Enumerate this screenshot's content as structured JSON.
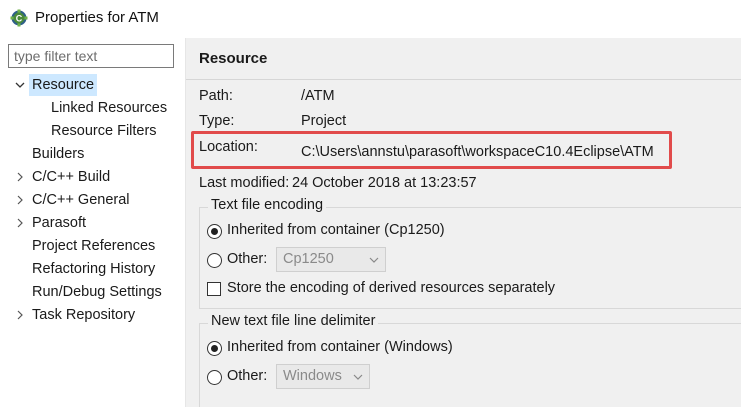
{
  "window": {
    "title": "Properties for ATM"
  },
  "filter": {
    "placeholder": "type filter text"
  },
  "tree": {
    "resource": "Resource",
    "linked_resources": "Linked Resources",
    "resource_filters": "Resource Filters",
    "builders": "Builders",
    "cpp_build": "C/C++ Build",
    "cpp_general": "C/C++ General",
    "parasoft": "Parasoft",
    "project_references": "Project References",
    "refactoring_history": "Refactoring History",
    "run_debug_settings": "Run/Debug Settings",
    "task_repository": "Task Repository"
  },
  "page": {
    "title": "Resource",
    "path_label": "Path:",
    "path_value": "/ATM",
    "type_label": "Type:",
    "type_value": "Project",
    "location_label": "Location:",
    "location_value": "C:\\Users\\annstu\\parasoft\\workspaceC10.4Eclipse\\ATM",
    "modified_label": "Last modified:",
    "modified_value": "24 October 2018 at 13:23:57"
  },
  "encoding": {
    "group_title": "Text file encoding",
    "inherited_label": "Inherited from container (Cp1250)",
    "other_label": "Other:",
    "other_value": "Cp1250",
    "store_label": "Store the encoding of derived resources separately"
  },
  "delimiter": {
    "group_title": "New text file line delimiter",
    "inherited_label": "Inherited from container (Windows)",
    "other_label": "Other:",
    "other_value": "Windows"
  },
  "colors": {
    "highlight": "#e14b4b",
    "selection": "#cde8ff",
    "panel_bg": "#f0f0f0"
  }
}
